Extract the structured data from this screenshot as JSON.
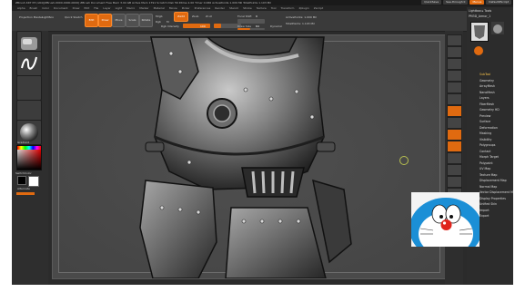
{
  "titlebar": {
    "title": "ZBrush 4R7 P3 (x64)[ZBrush-0000-0000-0000]  ZBrush Document  Free Mem 3.94 GB  Active Mem 1791  Scratch Disk 56  Rtime 2.00  Timer 0.066  ActivePoints 1.009 Mil  TotalPoints 1.103 Mil",
    "quicksave": "QuickSave",
    "see_through": "See-through 0",
    "menus_label": "Menus",
    "default_script": "DefaultZScript"
  },
  "menubar": [
    "Alpha",
    "Brush",
    "Color",
    "Document",
    "Draw",
    "Edit",
    "File",
    "Layer",
    "Light",
    "Macro",
    "Marker",
    "Material",
    "Movie",
    "Picker",
    "Preferences",
    "Render",
    "Stencil",
    "Stroke",
    "Texture",
    "Tool",
    "Transform",
    "Zplugin",
    "Zscript"
  ],
  "toolbar": {
    "projection_master": "Projection Master",
    "lightbox": "LightBox",
    "quick_sketch": "Quick Sketch",
    "edit": "Edit",
    "draw": "Draw",
    "move": "Move",
    "scale": "Scale",
    "rotate": "Rotate",
    "mrgb": "Mrgb",
    "rgb": "Rgb",
    "m": "M",
    "zadd": "Zadd",
    "zsub": "Zsub",
    "zcut": "Zcut",
    "rgb_intensity_label": "Rgb Intensity",
    "rgb_intensity": 100,
    "z_intensity_label": "Z Intensity",
    "z_intensity": 25,
    "focal_shift_label": "Focal Shift",
    "focal_shift": 0,
    "draw_size_label": "Draw Size",
    "draw_size": 64,
    "dynamic": "Dynamic",
    "active_points": "ActivePoints: 1.009 Mil",
    "total_points": "TotalPoints: 1.103 Mil"
  },
  "leftshelf": {
    "gradient_label": "Gradient",
    "switch_color_label": "SwitchColor",
    "alternate_label": "Alternate"
  },
  "righttray": {
    "header": "Lightbox ▸ Tools",
    "tool_name": "PM3D_Armor_1",
    "items": [
      "SubTool",
      "Geometry",
      "ArrayMesh",
      "NanoMesh",
      "Layers",
      "FiberMesh",
      "Geometry HD",
      "Preview",
      "Surface",
      "Deformation",
      "Masking",
      "Visibility",
      "Polygroups",
      "Contact",
      "Morph Target",
      "Polypaint",
      "UV Map",
      "Texture Map",
      "Displacement Map",
      "Normal Map",
      "Vector Displacement Map",
      "Display Properties",
      "Unified Skin",
      "Import",
      "Export"
    ]
  },
  "colors": {
    "accent": "#e06a10",
    "panel": "#2b2b2b",
    "viewport": "#4a4a4a"
  }
}
